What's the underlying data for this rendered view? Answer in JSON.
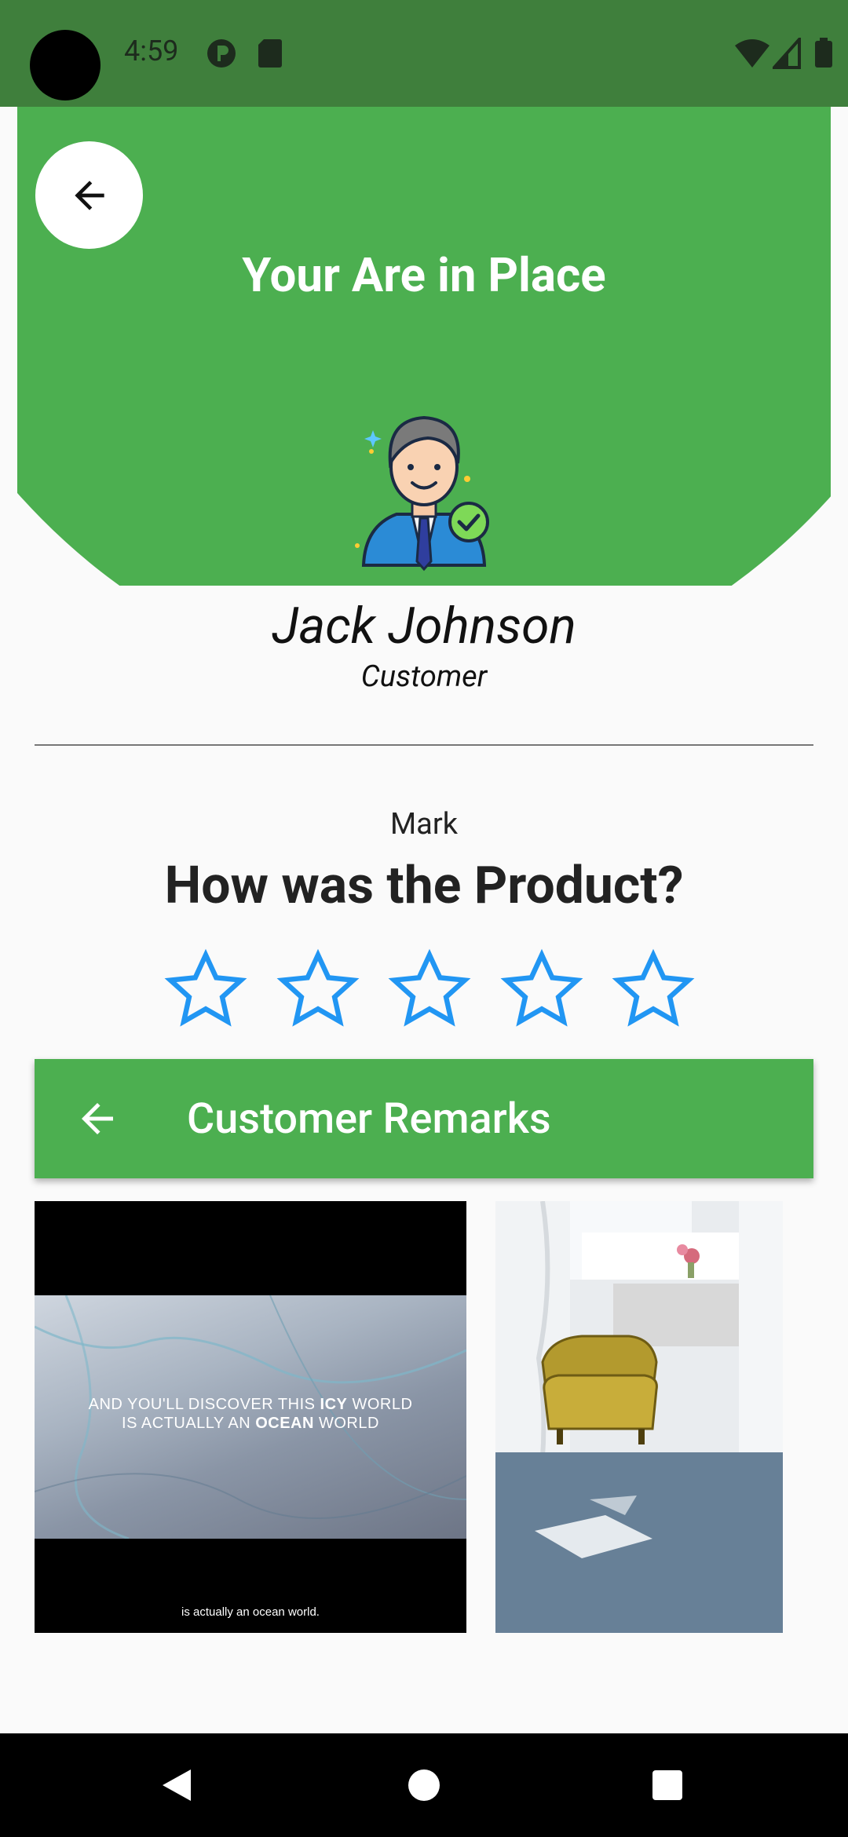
{
  "status_bar": {
    "time": "4:59",
    "icons": [
      "camera-hole",
      "play-protect-icon",
      "sd-card-icon",
      "wifi-icon",
      "signal-icon",
      "battery-icon"
    ]
  },
  "header": {
    "title": "Your Are in Place",
    "back_icon": "arrow-back-icon",
    "background_color": "#4caf50"
  },
  "profile": {
    "name": "Jack Johnson",
    "role": "Customer",
    "avatar_icon": "verified-user-avatar"
  },
  "rating": {
    "label": "Mark",
    "question": "How was the Product?",
    "max_stars": 5,
    "value": 0,
    "star_color": "#2196f3"
  },
  "remarks": {
    "title": "Customer Remarks",
    "back_icon": "arrow-back-icon"
  },
  "media": {
    "video_overlay_line1_a": "AND YOU'LL DISCOVER THIS",
    "video_overlay_line1_b": "ICY",
    "video_overlay_line1_c": "WORLD",
    "video_overlay_line2_a": "IS ACTUALLY AN",
    "video_overlay_line2_b": "OCEAN",
    "video_overlay_line2_c": "WORLD",
    "video_caption": "is actually an ocean world."
  },
  "nav": {
    "icons": [
      "back-triangle-icon",
      "home-circle-icon",
      "recents-square-icon"
    ]
  }
}
